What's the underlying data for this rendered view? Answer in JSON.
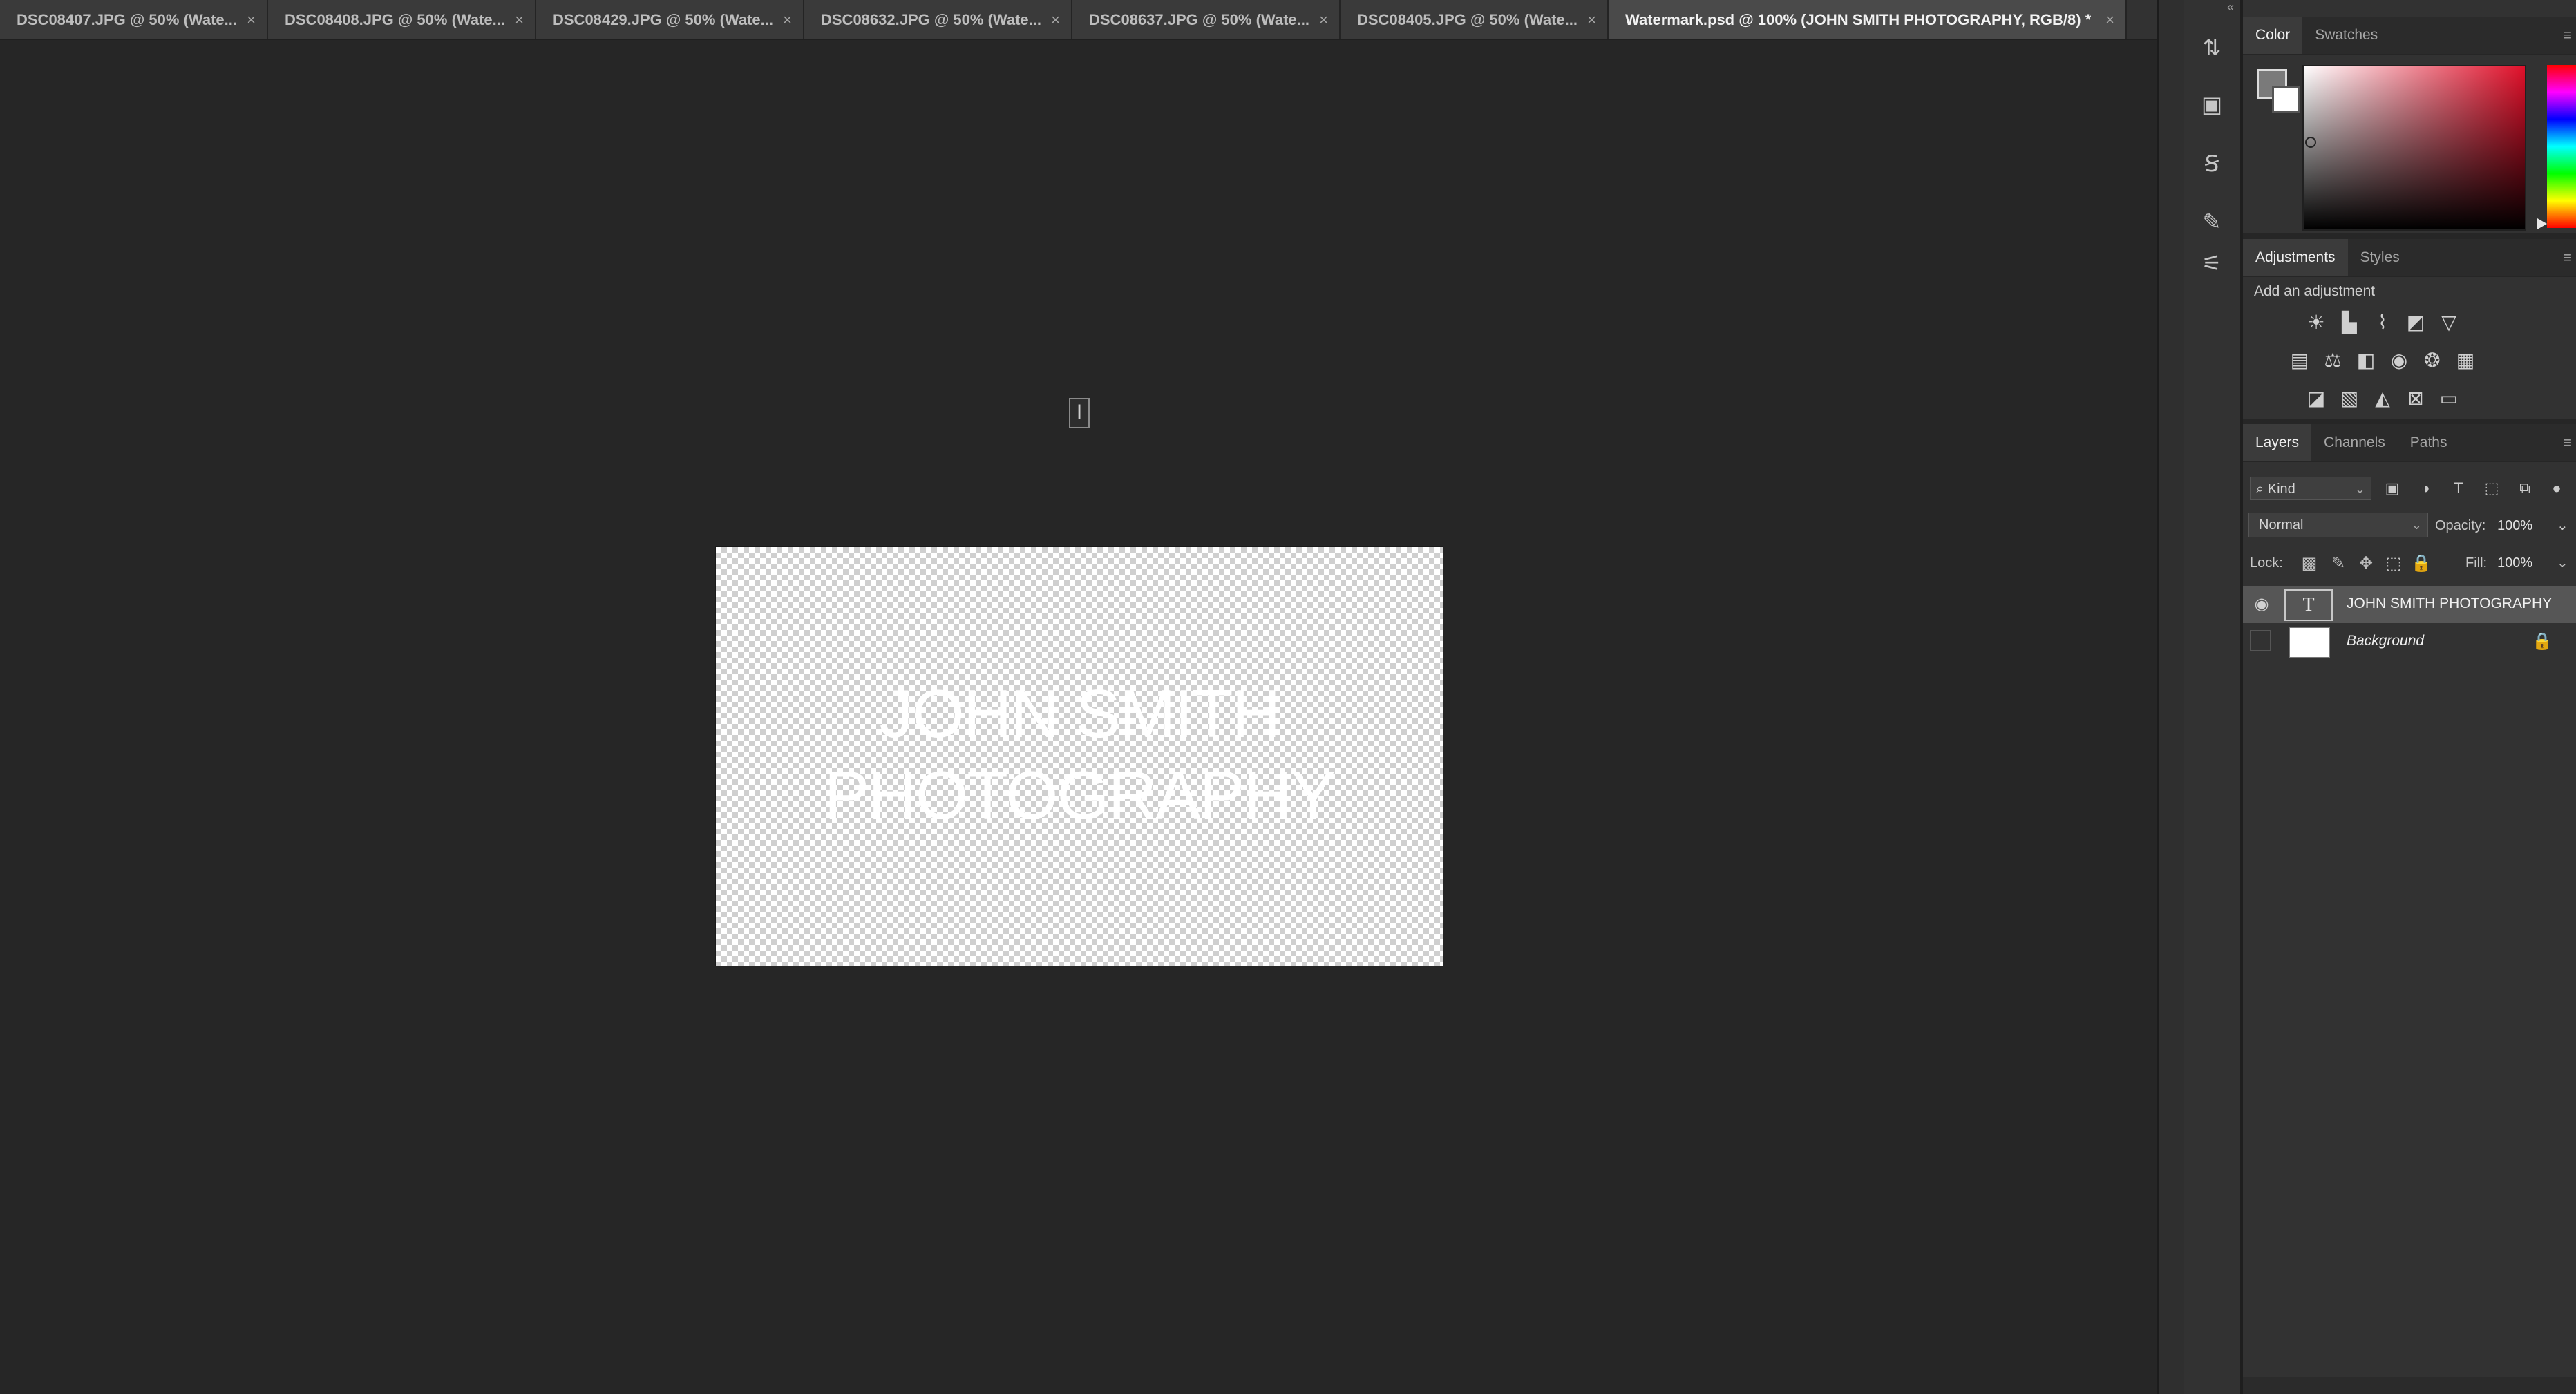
{
  "tabs": [
    {
      "label": "DSC08407.JPG @ 50% (Wate...",
      "close": "×",
      "active": false
    },
    {
      "label": "DSC08408.JPG @ 50% (Wate...",
      "close": "×",
      "active": false
    },
    {
      "label": "DSC08429.JPG @ 50% (Wate...",
      "close": "×",
      "active": false
    },
    {
      "label": "DSC08632.JPG @ 50% (Wate...",
      "close": "×",
      "active": false
    },
    {
      "label": "DSC08637.JPG @ 50% (Wate...",
      "close": "×",
      "active": false
    },
    {
      "label": "DSC08405.JPG @ 50% (Wate...",
      "close": "×",
      "active": false
    },
    {
      "label": "Watermark.psd @ 100% (JOHN SMITH PHOTOGRAPHY, RGB/8) *",
      "close": "×",
      "active": true
    }
  ],
  "canvas": {
    "watermark_text": "JOHN SMITH\nPHOTOGRAPHY",
    "cursor_glyph": "I"
  },
  "dock": {
    "collapse_glyph": "«",
    "tools": [
      {
        "icon": "history-brush-icon",
        "glyph": "⇅"
      },
      {
        "icon": "properties-icon",
        "glyph": "▣"
      },
      {
        "icon": "character-icon",
        "glyph": "Ꞩ"
      },
      {
        "icon": "brush-settings-icon",
        "glyph": "✎"
      },
      {
        "icon": "adjust-sliders-icon",
        "glyph": "⚟"
      }
    ]
  },
  "color_panel": {
    "tabs": [
      "Color",
      "Swatches"
    ],
    "active_tab": "Color",
    "menu_glyph": "≡",
    "foreground": "#7a7a7a",
    "background": "#ffffff",
    "hue": "#e0102a"
  },
  "adjustments_panel": {
    "tabs": [
      "Adjustments",
      "Styles"
    ],
    "title": "Add an adjustment",
    "menu_glyph": "≡",
    "rows": [
      [
        {
          "icon": "brightness-contrast-icon",
          "glyph": "☀"
        },
        {
          "icon": "levels-icon",
          "glyph": "▙"
        },
        {
          "icon": "curves-icon",
          "glyph": "⌇"
        },
        {
          "icon": "exposure-icon",
          "glyph": "◩"
        },
        {
          "icon": "vibrance-icon",
          "glyph": "▽"
        }
      ],
      [
        {
          "icon": "hue-saturation-icon",
          "glyph": "▤"
        },
        {
          "icon": "color-balance-icon",
          "glyph": "⚖"
        },
        {
          "icon": "black-white-icon",
          "glyph": "◧"
        },
        {
          "icon": "photo-filter-icon",
          "glyph": "◉"
        },
        {
          "icon": "channel-mixer-icon",
          "glyph": "❂"
        },
        {
          "icon": "color-lookup-icon",
          "glyph": "▦"
        }
      ],
      [
        {
          "icon": "invert-icon",
          "glyph": "◪"
        },
        {
          "icon": "posterize-icon",
          "glyph": "▧"
        },
        {
          "icon": "threshold-icon",
          "glyph": "◭"
        },
        {
          "icon": "selective-color-icon",
          "glyph": "⊠"
        },
        {
          "icon": "gradient-map-icon",
          "glyph": "▭"
        }
      ]
    ]
  },
  "layers_panel": {
    "tabs": [
      "Layers",
      "Channels",
      "Paths"
    ],
    "menu_glyph": "≡",
    "filter_label": "⌕ Kind",
    "filter_icons": [
      {
        "icon": "pixel-layer-filter-icon",
        "glyph": "▣"
      },
      {
        "icon": "adjustment-layer-filter-icon",
        "glyph": "◑"
      },
      {
        "icon": "type-layer-filter-icon",
        "glyph": "T"
      },
      {
        "icon": "shape-layer-filter-icon",
        "glyph": "⬚"
      },
      {
        "icon": "smart-object-filter-icon",
        "glyph": "⧉"
      },
      {
        "icon": "filter-toggle-icon",
        "glyph": "●"
      }
    ],
    "blend_mode": "Normal",
    "opacity_label": "Opacity:",
    "opacity_value": "100%",
    "lock_label": "Lock:",
    "fill_label": "Fill:",
    "fill_value": "100%",
    "lock_icons": [
      {
        "icon": "lock-transparent-icon",
        "glyph": "▩"
      },
      {
        "icon": "lock-pixels-icon",
        "glyph": "✎"
      },
      {
        "icon": "lock-position-icon",
        "glyph": "✥"
      },
      {
        "icon": "lock-artboard-icon",
        "glyph": "⬚"
      },
      {
        "icon": "lock-all-icon",
        "glyph": "🔒"
      }
    ],
    "layers": [
      {
        "name": "JOHN SMITH PHOTOGRAPHY",
        "type": "text",
        "thumb_glyph": "T",
        "visible": true,
        "selected": true,
        "locked": false
      },
      {
        "name": "Background",
        "type": "pixel",
        "thumb_glyph": "",
        "visible": false,
        "selected": false,
        "locked": true
      }
    ],
    "eye_glyph": "◉",
    "lock_glyph": "🔒"
  }
}
